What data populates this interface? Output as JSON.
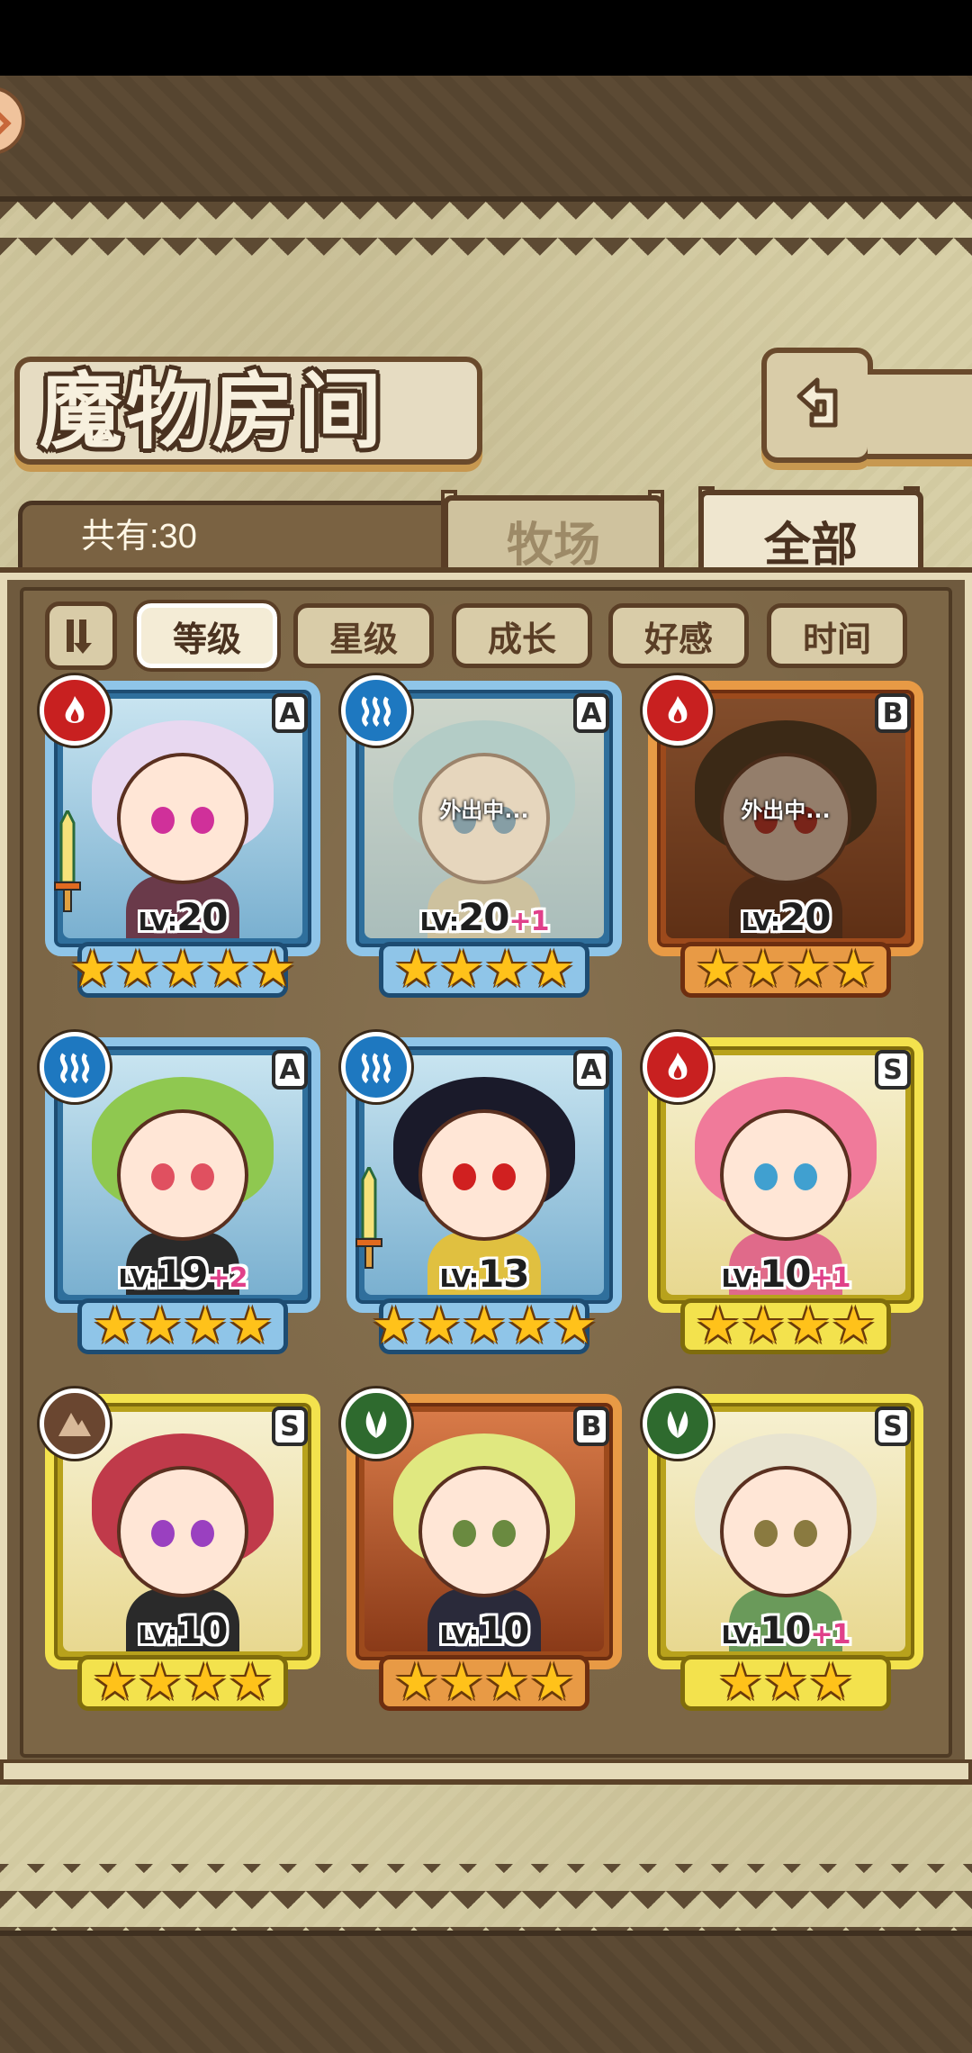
{
  "header": {
    "title": "魔物房间",
    "count_text": "共有:30"
  },
  "tabs": [
    {
      "label": "牧场",
      "active": false
    },
    {
      "label": "全部",
      "active": true
    }
  ],
  "sort": {
    "buttons": [
      {
        "label": "等级",
        "active": true
      },
      {
        "label": "星级",
        "active": false
      },
      {
        "label": "成长",
        "active": false
      },
      {
        "label": "好感",
        "active": false
      },
      {
        "label": "时间",
        "active": false
      }
    ]
  },
  "monsters": [
    {
      "element": "fire",
      "rarity": "A",
      "level": "20",
      "bonus": "",
      "stars": 5,
      "away": false,
      "weapon": true,
      "hair": "#e8d8f0",
      "eye": "#d0309a",
      "body": "#6a3a4a"
    },
    {
      "element": "water",
      "rarity": "A",
      "level": "20",
      "bonus": "+1",
      "stars": 4,
      "away": true,
      "away_text": "外出中...",
      "weapon": false,
      "hair": "#8fd0e8",
      "eye": "#2a6aa0",
      "body": "#c8b890"
    },
    {
      "element": "fire",
      "rarity": "B",
      "level": "20",
      "bonus": "",
      "stars": 4,
      "away": true,
      "away_text": "外出中...",
      "weapon": false,
      "hair": "#3a2a1a",
      "eye": "#c02020",
      "body": "#5a2a1a"
    },
    {
      "element": "water",
      "rarity": "A",
      "level": "19",
      "bonus": "+2",
      "stars": 4,
      "away": false,
      "weapon": false,
      "hair": "#8fc850",
      "eye": "#e05060",
      "body": "#2a2a2a"
    },
    {
      "element": "water",
      "rarity": "A",
      "level": "13",
      "bonus": "",
      "stars": 5,
      "away": false,
      "weapon": true,
      "hair": "#1a1a2a",
      "eye": "#d02020",
      "body": "#e0c040"
    },
    {
      "element": "fire",
      "rarity": "S",
      "level": "10",
      "bonus": "+1",
      "stars": 4,
      "away": false,
      "weapon": false,
      "hair": "#f07a9a",
      "eye": "#40a0d0",
      "body": "#e06a8a"
    },
    {
      "element": "earth",
      "rarity": "S",
      "level": "10",
      "bonus": "",
      "stars": 4,
      "away": false,
      "weapon": false,
      "hair": "#c03a4a",
      "eye": "#9a40c0",
      "body": "#2a2a2a"
    },
    {
      "element": "wood",
      "rarity": "B",
      "level": "10",
      "bonus": "",
      "stars": 4,
      "away": false,
      "weapon": false,
      "hair": "#e0e880",
      "eye": "#6a8a40",
      "body": "#2a2a3a"
    },
    {
      "element": "wood",
      "rarity": "S",
      "level": "10",
      "bonus": "+1",
      "stars": 3,
      "away": false,
      "weapon": false,
      "hair": "#e8e4d0",
      "eye": "#8a7a40",
      "body": "#6a9a5a"
    }
  ],
  "colors": {
    "fire": "#c82020",
    "water": "#1e78c0",
    "earth": "#6a4630",
    "wood": "#2e6a2e",
    "rarity_A": "#8fc5e8",
    "rarity_B": "#e89a45",
    "rarity_S": "#f3e24d"
  }
}
